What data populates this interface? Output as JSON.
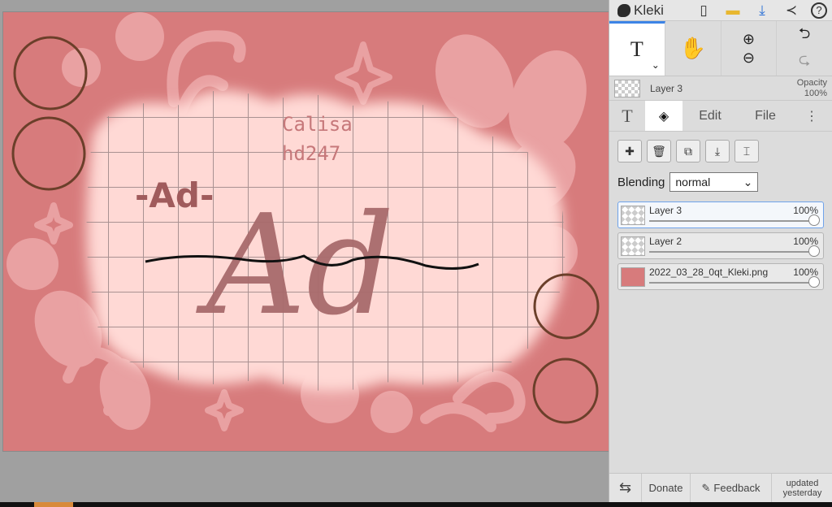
{
  "app": {
    "name": "Kleki"
  },
  "topbar": {
    "icons": [
      "new-icon",
      "open-folder-icon",
      "download-icon",
      "share-icon",
      "help-icon"
    ],
    "help_label": "?"
  },
  "toolbar": {
    "text_tool": "T",
    "undo_label": "⮌",
    "redo_label": "⮎"
  },
  "current_layer": {
    "name": "Layer 3",
    "opacity_label": "Opacity",
    "opacity_value": "100%"
  },
  "tabs": {
    "text": "T",
    "edit": "Edit",
    "file": "File",
    "more": "⋮"
  },
  "blending": {
    "label": "Blending",
    "value": "normal"
  },
  "layers": [
    {
      "name": "Layer 3",
      "opacity": "100%",
      "selected": true
    },
    {
      "name": "Layer 2",
      "opacity": "100%",
      "selected": false
    },
    {
      "name": "2022_03_28_0qt_Kleki.png",
      "opacity": "100%",
      "selected": false
    }
  ],
  "footer": {
    "donate": "Donate",
    "feedback": "Feedback",
    "updated_line1": "updated",
    "updated_line2": "yesterday"
  },
  "canvas": {
    "text_name": "Calisa",
    "text_tag": "hd247",
    "text_ad": "-Ad-",
    "text_big": "Ad",
    "colors": {
      "bg": "#d77b7c",
      "light": "#ffd9d5",
      "mid": "#e9a1a2",
      "dark": "#a05b5c",
      "ring": "#6b3f2a"
    }
  }
}
